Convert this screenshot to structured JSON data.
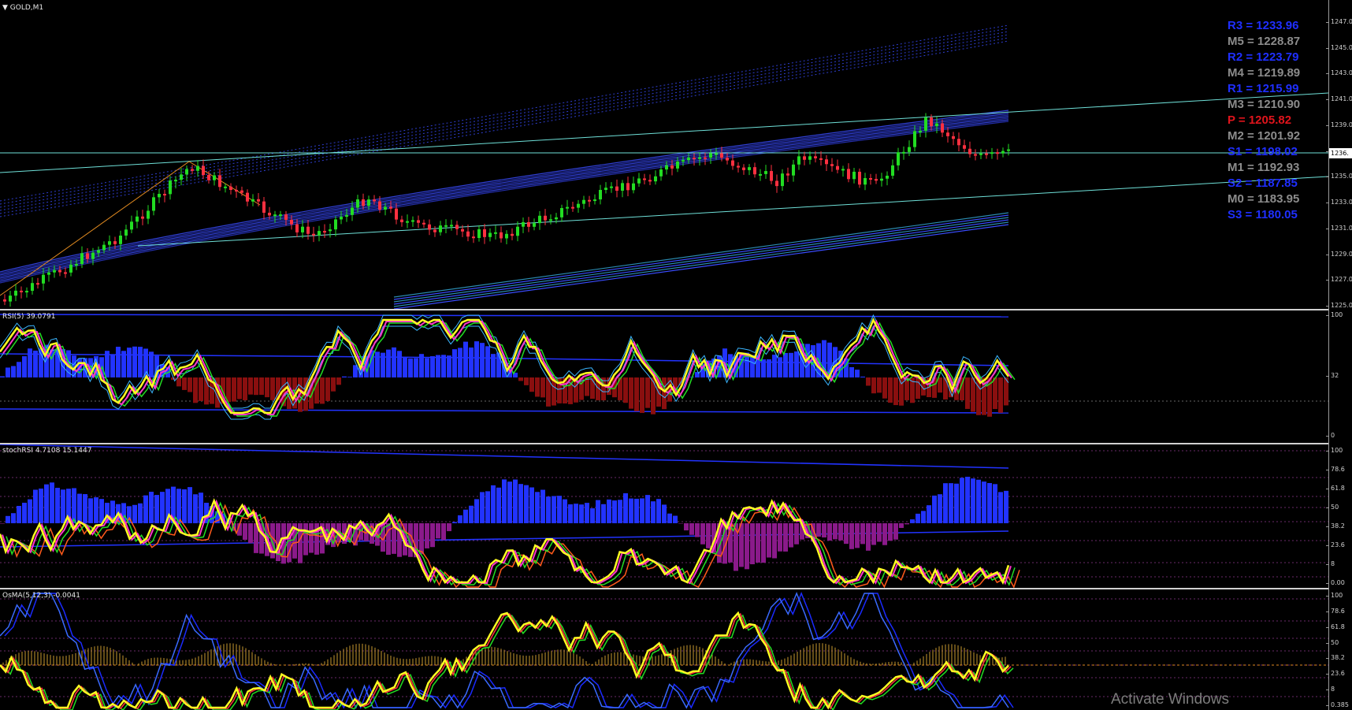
{
  "main": {
    "title": "GOLD,M1",
    "price_box": "1236.",
    "price_ticks": [
      "1247.0",
      "1245.0",
      "1243.0",
      "1241.0",
      "1239.0",
      "1237.0",
      "1235.0",
      "1233.0",
      "1231.0",
      "1229.0",
      "1227.0",
      "1225.0"
    ],
    "pivots": [
      {
        "label": "R3 = 1233.96",
        "color": "#1f2fff"
      },
      {
        "label": "M5 = 1228.87",
        "color": "#8c8c8c"
      },
      {
        "label": "R2 = 1223.79",
        "color": "#1f2fff"
      },
      {
        "label": "M4 = 1219.89",
        "color": "#8c8c8c"
      },
      {
        "label": "R1 = 1215.99",
        "color": "#1f2fff"
      },
      {
        "label": "M3 = 1210.90",
        "color": "#8c8c8c"
      },
      {
        "label": "P  = 1205.82",
        "color": "#e0141c"
      },
      {
        "label": "M2 = 1201.92",
        "color": "#8c8c8c"
      },
      {
        "label": "S1 = 1198.02",
        "color": "#1f2fff"
      },
      {
        "label": "M1 = 1192.93",
        "color": "#8c8c8c"
      },
      {
        "label": "S2 = 1187.85",
        "color": "#1f2fff"
      },
      {
        "label": "M0 = 1183.95",
        "color": "#8c8c8c"
      },
      {
        "label": "S3 = 1180.05",
        "color": "#1f2fff"
      }
    ]
  },
  "rsi": {
    "label": "RSI(5) 39.0791",
    "ticks": [
      "100",
      "32",
      "0"
    ]
  },
  "stoch": {
    "label": "stochRSI 4.7108 15.1447",
    "ticks": [
      "100",
      "78.6",
      "61.8",
      "50",
      "38.2",
      "23.6",
      "8",
      "0.00"
    ]
  },
  "osma": {
    "label": "OsMA(5,12,3) -0.0041",
    "ticks": [
      "100",
      "78.6",
      "61.8",
      "50",
      "38.2",
      "23.6",
      "8",
      "0.385"
    ]
  },
  "colors": {
    "bull": "#22dd22",
    "bear": "#ff3040",
    "rsi_line": "#ffff22",
    "accent_blue": "#2233ff",
    "cyan": "#6fe0d8",
    "magenta": "#ff33cc",
    "dark_red": "#8a0f0f",
    "purple": "#8a1a8a"
  },
  "watermark": "Activate Windows"
}
